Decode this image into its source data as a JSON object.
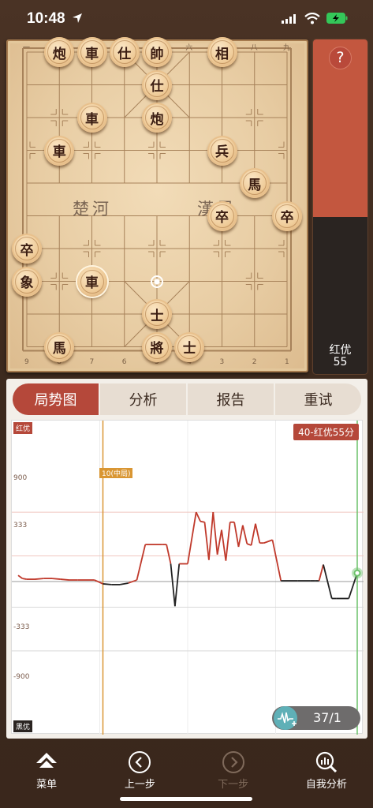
{
  "status": {
    "time": "10:48"
  },
  "board": {
    "river_left": "楚河",
    "river_right": "漢界",
    "top_columns": [
      "一",
      "二",
      "三",
      "四",
      "五",
      "六",
      "七",
      "八",
      "九"
    ],
    "bottom_columns": [
      "9",
      "8",
      "7",
      "6",
      "5",
      "4",
      "3",
      "2",
      "1"
    ],
    "pieces": [
      {
        "c": 1,
        "r": 0,
        "t": "炮"
      },
      {
        "c": 2,
        "r": 0,
        "t": "車"
      },
      {
        "c": 3,
        "r": 0,
        "t": "仕"
      },
      {
        "c": 4,
        "r": 0,
        "t": "帥"
      },
      {
        "c": 6,
        "r": 0,
        "t": "相"
      },
      {
        "c": 4,
        "r": 1,
        "t": "仕"
      },
      {
        "c": 2,
        "r": 2,
        "t": "車"
      },
      {
        "c": 4,
        "r": 2,
        "t": "炮"
      },
      {
        "c": 1,
        "r": 3,
        "t": "車"
      },
      {
        "c": 6,
        "r": 3,
        "t": "兵"
      },
      {
        "c": 7,
        "r": 4,
        "t": "馬"
      },
      {
        "c": 6,
        "r": 5,
        "t": "卒"
      },
      {
        "c": 8,
        "r": 5,
        "t": "卒"
      },
      {
        "c": 0,
        "r": 6,
        "t": "卒"
      },
      {
        "c": 0,
        "r": 7,
        "t": "象"
      },
      {
        "c": 2,
        "r": 7,
        "t": "車",
        "selected": true
      },
      {
        "c": 4,
        "r": 8,
        "t": "士"
      },
      {
        "c": 1,
        "r": 9,
        "t": "馬"
      },
      {
        "c": 4,
        "r": 9,
        "t": "將"
      },
      {
        "c": 5,
        "r": 9,
        "t": "士"
      }
    ],
    "target": {
      "c": 4,
      "r": 7
    }
  },
  "evaluation": {
    "help_label": "?",
    "side": "红优",
    "score": "55",
    "red_fraction": 0.53
  },
  "tabs": [
    {
      "label": "局势图",
      "active": true
    },
    {
      "label": "分析",
      "active": false
    },
    {
      "label": "报告",
      "active": false
    },
    {
      "label": "重试",
      "active": false
    }
  ],
  "chart_data": {
    "type": "line",
    "top_tag": "红优",
    "bottom_tag": "黑优",
    "badge": "40-红优55分",
    "phase_label": "10(中局)",
    "phase_move": 10,
    "current_move": 40,
    "y_ticks": [
      "900",
      "333",
      "-333",
      "-900"
    ],
    "ylim": [
      -1300,
      1300
    ],
    "xlim": [
      0,
      40
    ],
    "colors": {
      "red": "#c0392b",
      "black": "#222222",
      "phase": "#d99633",
      "current": "#6cc26a"
    },
    "x": [
      0,
      0.5,
      1,
      2,
      3,
      4,
      5,
      6,
      7,
      8,
      9,
      10,
      11,
      12,
      13,
      14,
      15,
      16,
      17,
      17.5,
      18,
      18.5,
      19,
      20,
      21,
      21.5,
      22,
      22.5,
      23,
      23.5,
      24,
      24.5,
      25,
      25.5,
      26,
      26.5,
      27,
      27.5,
      28,
      28.5,
      29,
      30,
      31,
      32,
      33,
      34,
      34.5,
      35,
      35.5,
      36,
      37,
      37.5,
      38,
      39,
      40
    ],
    "values": [
      80,
      40,
      30,
      30,
      40,
      40,
      30,
      20,
      20,
      20,
      20,
      -30,
      -40,
      -40,
      -20,
      20,
      480,
      480,
      480,
      480,
      230,
      -320,
      230,
      230,
      900,
      780,
      770,
      280,
      900,
      350,
      670,
      270,
      770,
      770,
      450,
      730,
      490,
      470,
      750,
      500,
      500,
      540,
      10,
      10,
      10,
      10,
      10,
      10,
      10,
      220,
      -220,
      -220,
      -220,
      -220,
      110
    ],
    "move_counter": "37/1"
  },
  "nav": [
    {
      "label": "菜单",
      "icon": "menu-icon",
      "disabled": false
    },
    {
      "label": "上一步",
      "icon": "prev-icon",
      "disabled": false
    },
    {
      "label": "下一步",
      "icon": "next-icon",
      "disabled": true
    },
    {
      "label": "自我分析",
      "icon": "analysis-icon",
      "disabled": false
    }
  ]
}
